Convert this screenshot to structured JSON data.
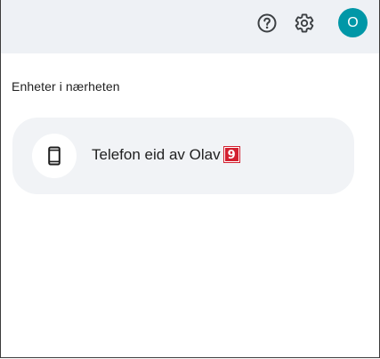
{
  "header": {
    "help_icon": "help-circle-icon",
    "settings_icon": "gear-icon",
    "avatar_initial": "O",
    "avatar_color": "#0097a7"
  },
  "nearby": {
    "title": "Enheter i nærheten",
    "devices": [
      {
        "label": "Telefon eid av Olav",
        "icon": "phone-icon",
        "badge": "9"
      }
    ]
  }
}
